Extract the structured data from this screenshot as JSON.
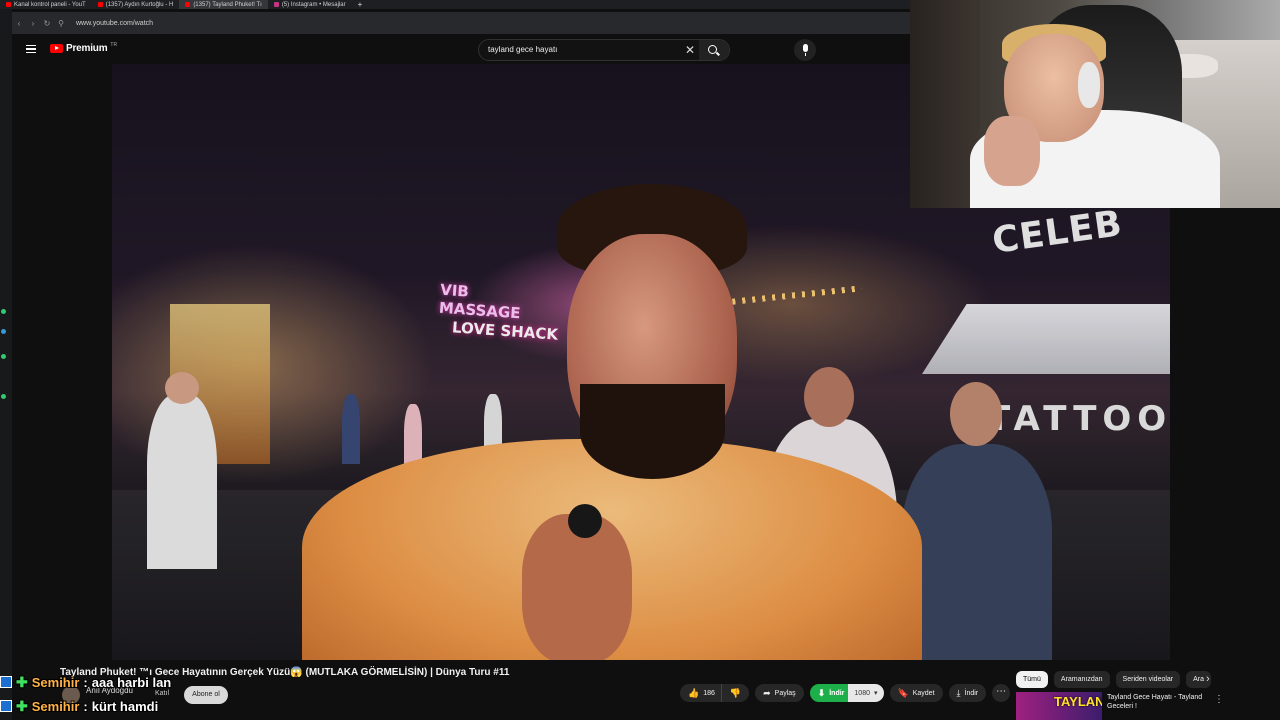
{
  "browser": {
    "tabs": [
      {
        "label": "Kanal kontrol paneli - YouT",
        "type": "yt"
      },
      {
        "label": "(1357) Aydın Kurtoğlu - H",
        "type": "yt"
      },
      {
        "label": "(1357) Tayland Phuket! Tı",
        "type": "yt",
        "active": true
      },
      {
        "label": "(5) Instagram • Mesajlar",
        "type": "ig"
      }
    ],
    "new_tab": "+",
    "url": "www.youtube.com/watch"
  },
  "youtube": {
    "logo_text": "Premium",
    "logo_sup": "TR",
    "search_query": "tayland gece hayatı",
    "clear_glyph": "✕"
  },
  "video_overlay_text": {
    "sign1": "VIB MASSAGE",
    "sign2": "LOVE SHACK",
    "sign3": "CELEB",
    "sign4": "TATTOO"
  },
  "video_info": {
    "title": "Tayland Phuket! ™ı Gece Hayatının Gerçek Yüzü😱 (MUTLAKA GÖRMELİSİN) | Dünya Turu #11",
    "channel": "Anıl Aydoğdu",
    "join_label": "Katıl",
    "subscribe_label": "Abone ol",
    "like_count": "186",
    "share_label": "Paylaş",
    "download_green_label": "İndir",
    "download_count": "1080",
    "save_label": "Kaydet",
    "download_label": "İndir",
    "more_glyph": "⋯"
  },
  "sidebar": {
    "chips": [
      "Tümü",
      "Aramanızdan",
      "Seriden videolar",
      "Ara"
    ],
    "rec_thumb_text": "TAYLAND",
    "rec_title": "Tayland Gece Hayatı - Tayland Geceleri !"
  },
  "chat": [
    {
      "name": "Semihir",
      "message": "aaa harbi lan"
    },
    {
      "name": "Semihir",
      "message": "kürt hamdi"
    }
  ],
  "colors": {
    "yt_red": "#ff0000",
    "download_green": "#1db04a",
    "chat_name": "#ffb347"
  }
}
